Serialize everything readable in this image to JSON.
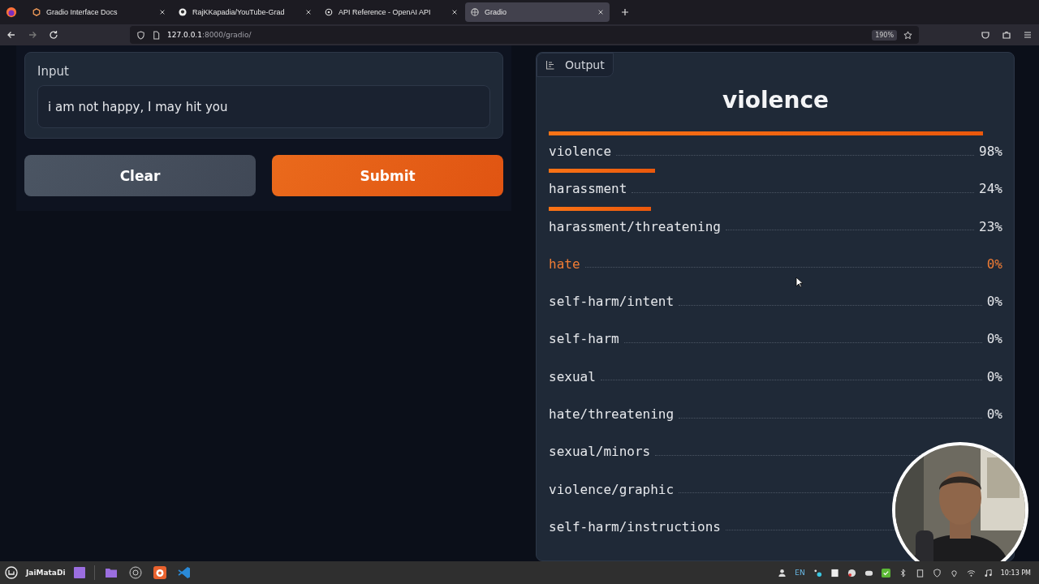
{
  "browser": {
    "tabs": [
      {
        "title": "Gradio Interface Docs",
        "selected": false
      },
      {
        "title": "RajKKapadia/YouTube-Grad",
        "selected": false
      },
      {
        "title": "API Reference - OpenAI API",
        "selected": false
      },
      {
        "title": "Gradio",
        "selected": true
      }
    ],
    "address": {
      "host": "127.0.0.1",
      "path": ":8000/gradio/"
    },
    "zoom": "190%"
  },
  "input": {
    "label": "Input",
    "value": "i am not happy, I may hit you"
  },
  "buttons": [
    {
      "label": "Clear",
      "kind": "secondary"
    },
    {
      "label": "Submit",
      "kind": "primary"
    }
  ],
  "output": {
    "label": "Output",
    "top_label": "violence",
    "rows": [
      {
        "label": "violence",
        "percent": "98%",
        "highlighted": false
      },
      {
        "label": "harassment",
        "percent": "24%",
        "highlighted": false
      },
      {
        "label": "harassment/threatening",
        "percent": "23%",
        "highlighted": false
      },
      {
        "label": "hate",
        "percent": "0%",
        "highlighted": true
      },
      {
        "label": "self-harm/intent",
        "percent": "0%",
        "highlighted": false
      },
      {
        "label": "self-harm",
        "percent": "0%",
        "highlighted": false
      },
      {
        "label": "sexual",
        "percent": "0%",
        "highlighted": false
      },
      {
        "label": "hate/threatening",
        "percent": "0%",
        "highlighted": false
      },
      {
        "label": "sexual/minors",
        "highlighted": false
      },
      {
        "label": "violence/graphic",
        "highlighted": false
      },
      {
        "label": "self-harm/instructions",
        "highlighted": false
      }
    ]
  },
  "taskbar": {
    "user": "JaiMataDi",
    "language": "EN",
    "time": "10:13 PM"
  }
}
